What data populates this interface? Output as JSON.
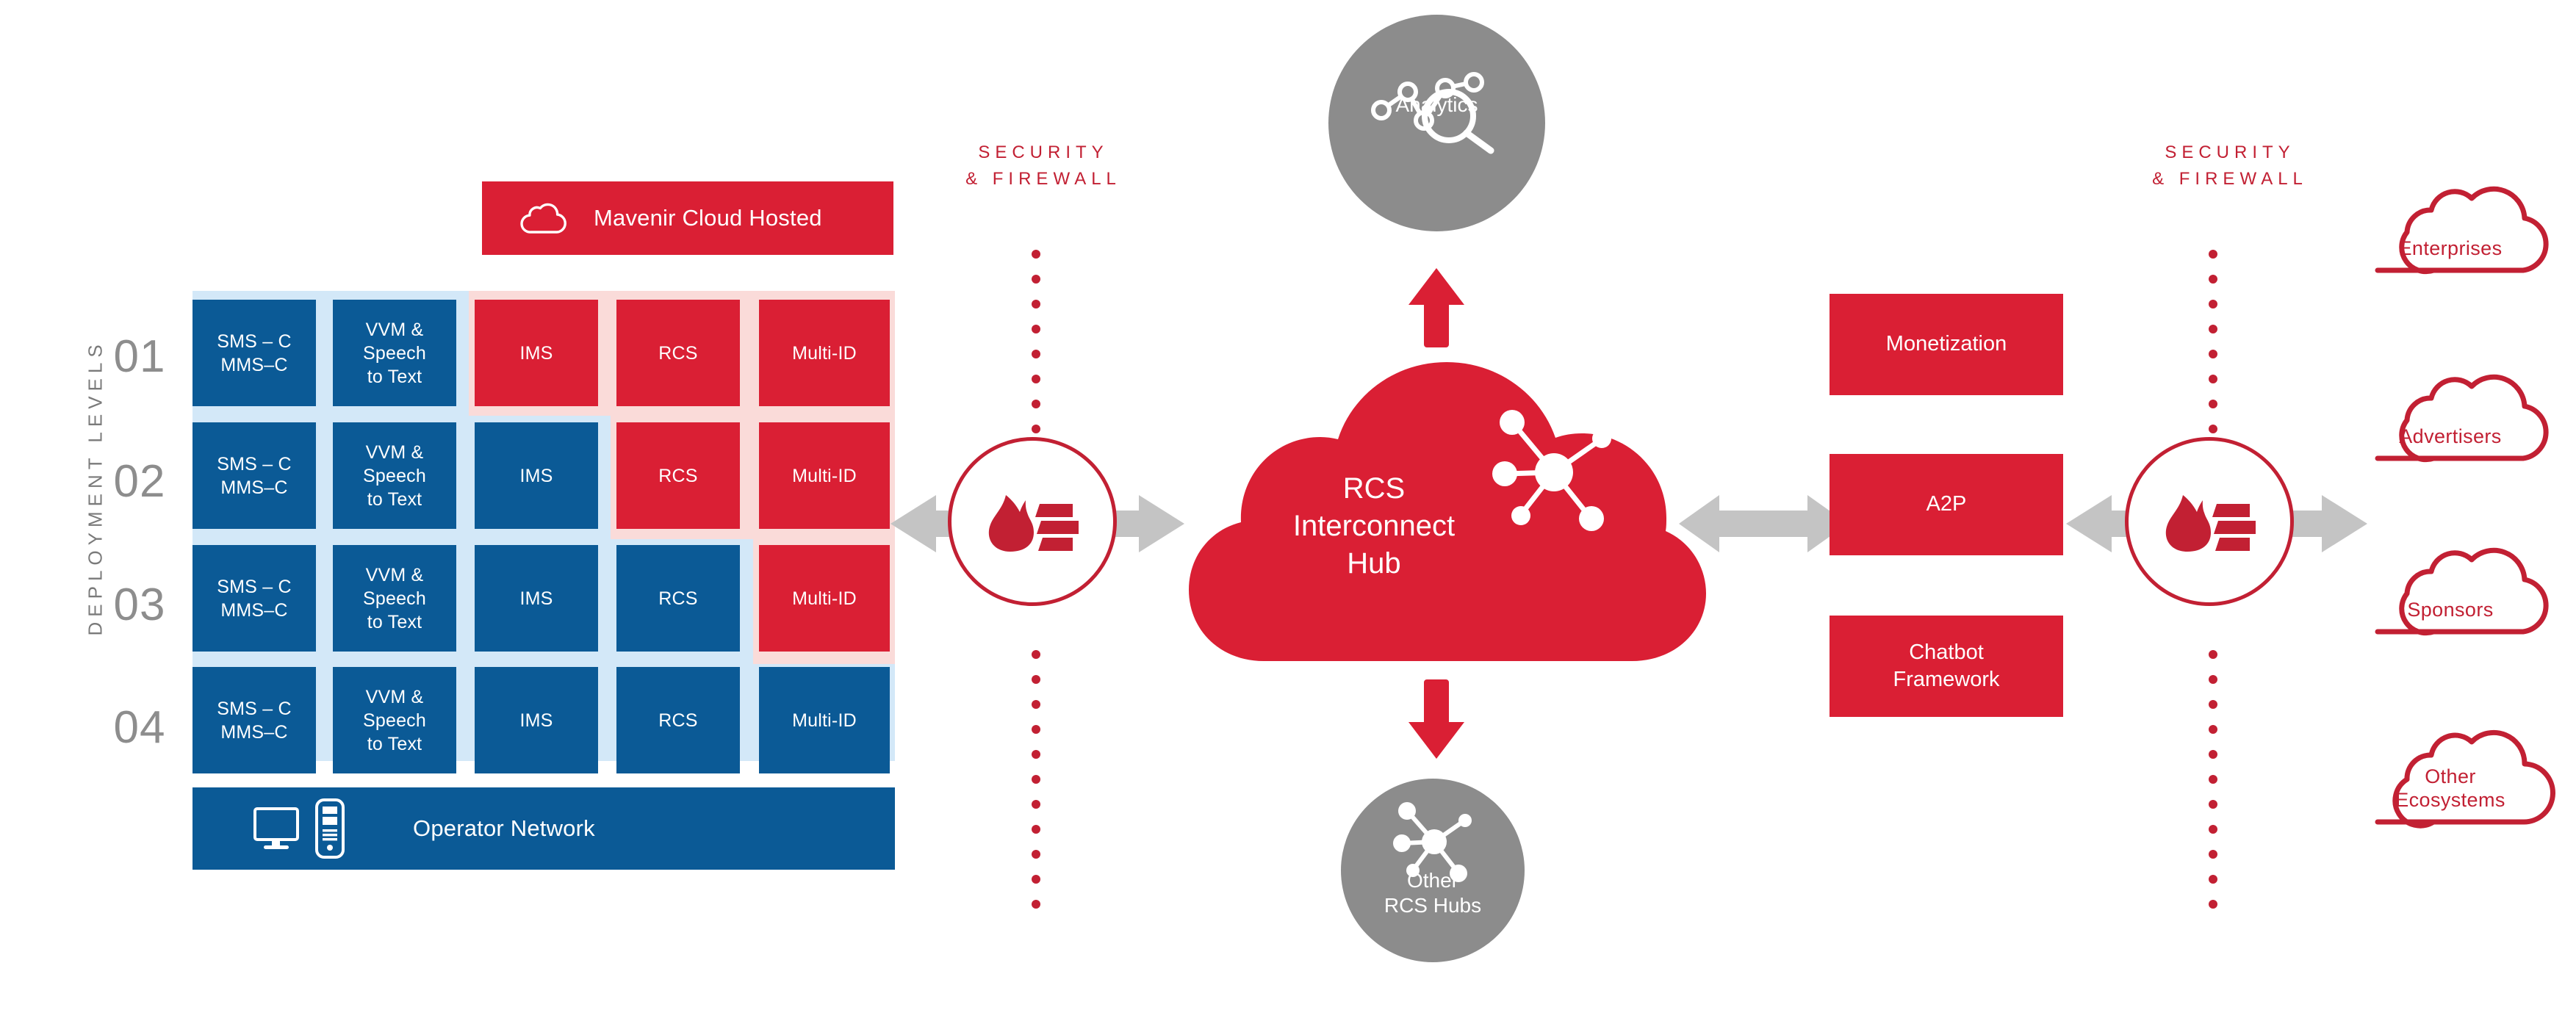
{
  "colors": {
    "blue": "#0b5a96",
    "red": "#da1f34",
    "red_text": "#c22033",
    "light_blue_backdrop": "#d3e8f8",
    "pink_backdrop": "#fadbd9",
    "gray_circle": "#8c8c8c",
    "gray_arrow": "#c4c4c4",
    "level_number_text": "#8d8d8d"
  },
  "left_panel": {
    "axis_label": "DEPLOYMENT LEVELS",
    "level_numbers": [
      "01",
      "02",
      "03",
      "04"
    ],
    "cloud_banner": {
      "label": "Mavenir Cloud Hosted",
      "icon": "cloud-outline-icon"
    },
    "operator_bar": {
      "label": "Operator Network",
      "icons": [
        "monitor-icon",
        "desktop-tower-icon"
      ]
    },
    "column_labels": [
      "SMS – C\nMMS–C",
      "VVM &\nSpeech\nto Text",
      "IMS",
      "RCS",
      "Multi-ID"
    ],
    "rows": [
      {
        "level": "01",
        "cells": [
          {
            "label_line1": "SMS – C",
            "label_line2": "MMS–C",
            "color": "blue"
          },
          {
            "label_line1": "VVM &",
            "label_line2": "Speech",
            "label_line3": "to Text",
            "color": "blue"
          },
          {
            "label_line1": "IMS",
            "color": "red"
          },
          {
            "label_line1": "RCS",
            "color": "red"
          },
          {
            "label_line1": "Multi-ID",
            "color": "red"
          }
        ]
      },
      {
        "level": "02",
        "cells": [
          {
            "label_line1": "SMS – C",
            "label_line2": "MMS–C",
            "color": "blue"
          },
          {
            "label_line1": "VVM &",
            "label_line2": "Speech",
            "label_line3": "to Text",
            "color": "blue"
          },
          {
            "label_line1": "IMS",
            "color": "blue"
          },
          {
            "label_line1": "RCS",
            "color": "red"
          },
          {
            "label_line1": "Multi-ID",
            "color": "red"
          }
        ]
      },
      {
        "level": "03",
        "cells": [
          {
            "label_line1": "SMS – C",
            "label_line2": "MMS–C",
            "color": "blue"
          },
          {
            "label_line1": "VVM &",
            "label_line2": "Speech",
            "label_line3": "to Text",
            "color": "blue"
          },
          {
            "label_line1": "IMS",
            "color": "blue"
          },
          {
            "label_line1": "RCS",
            "color": "blue"
          },
          {
            "label_line1": "Multi-ID",
            "color": "red"
          }
        ]
      },
      {
        "level": "04",
        "cells": [
          {
            "label_line1": "SMS – C",
            "label_line2": "MMS–C",
            "color": "blue"
          },
          {
            "label_line1": "VVM &",
            "label_line2": "Speech",
            "label_line3": "to Text",
            "color": "blue"
          },
          {
            "label_line1": "IMS",
            "color": "blue"
          },
          {
            "label_line1": "RCS",
            "color": "blue"
          },
          {
            "label_line1": "Multi-ID",
            "color": "blue"
          }
        ]
      }
    ]
  },
  "firewall_left": {
    "title_line1": "SECURITY",
    "title_line2": "& FIREWALL",
    "icon": "firewall-flame-brick-icon"
  },
  "firewall_right": {
    "title_line1": "SECURITY",
    "title_line2": "& FIREWALL",
    "icon": "firewall-flame-brick-icon"
  },
  "center": {
    "hub": {
      "label_line1": "RCS",
      "label_line2": "Interconnect",
      "label_line3": "Hub",
      "icon": "network-nodes-icon"
    },
    "analytics": {
      "label": "Analytics",
      "icon": "analytics-chart-magnifier-icon"
    },
    "other_hubs": {
      "label_line1": "Other",
      "label_line2": "RCS Hubs",
      "icon": "network-nodes-icon"
    },
    "arrow_up": "arrow-up-icon",
    "arrow_down": "arrow-down-icon"
  },
  "services": [
    {
      "label_line1": "Monetization"
    },
    {
      "label_line1": "A2P"
    },
    {
      "label_line1": "Chatbot",
      "label_line2": "Framework"
    }
  ],
  "ecosystems": [
    {
      "label_line1": "Enterprises"
    },
    {
      "label_line1": "Advertisers"
    },
    {
      "label_line1": "Sponsors"
    },
    {
      "label_line1": "Other",
      "label_line2": "Ecosystems"
    }
  ]
}
